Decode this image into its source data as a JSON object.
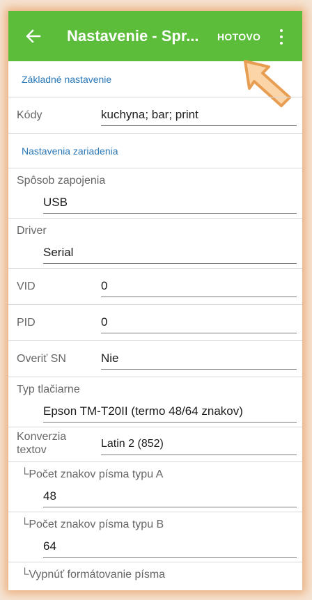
{
  "appbar": {
    "back_icon": "arrow-left-icon",
    "title": "Nastavenie - Spr...",
    "done_label": "HOTOVO",
    "menu_icon": "more-vertical-icon",
    "color": "#5bbd3a"
  },
  "pointer_icon": "hand-pointer-arrow-icon",
  "sections": {
    "basic": "Základné nastavenie",
    "device": "Nastavenia zariadenia"
  },
  "settings": {
    "codes": {
      "label": "Kódy",
      "value": "kuchyna; bar; print"
    },
    "connection": {
      "label": "Spôsob zapojenia",
      "value": "USB"
    },
    "driver": {
      "label": "Driver",
      "value": "Serial"
    },
    "vid": {
      "label": "VID",
      "value": "0"
    },
    "pid": {
      "label": "PID",
      "value": "0"
    },
    "verify_sn": {
      "label": "Overiť SN",
      "value": "Nie"
    },
    "printer_type": {
      "label": "Typ tlačiarne",
      "value": "Epson TM-T20II (termo 48/64 znakov)"
    },
    "conversion": {
      "label_line1": "Konverzia",
      "label_line2": "textov",
      "value": "Latin 2 (852)"
    },
    "font_a_chars": {
      "label": "└Počet znakov písma typu A",
      "value": "48"
    },
    "font_b_chars": {
      "label": "└Počet znakov písma typu B",
      "value": "64"
    },
    "disable_formatting": {
      "label": "└Vypnúť formátovanie písma"
    }
  }
}
